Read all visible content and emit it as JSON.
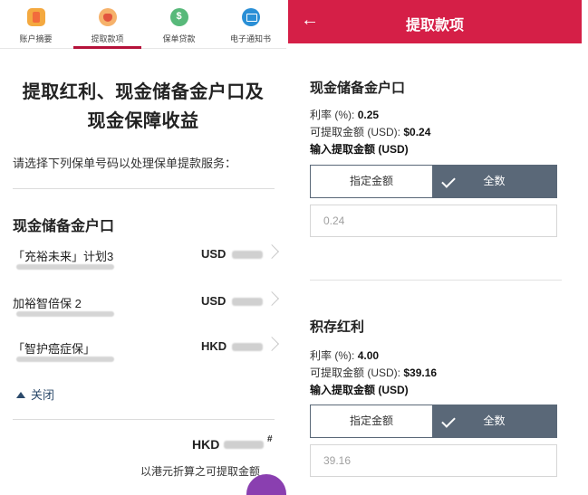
{
  "left_screen": {
    "tabs": [
      {
        "label": "账户摘要",
        "icon": "account-summary-icon"
      },
      {
        "label": "提取款项",
        "icon": "withdrawal-icon",
        "active": true
      },
      {
        "label": "保单贷款",
        "icon": "policy-loan-icon"
      },
      {
        "label": "电子通知书",
        "icon": "e-notice-mail-icon"
      }
    ],
    "title_line1": "提取红利、现金储备金户口及",
    "title_line2": "现金保障收益",
    "instruction": "请选择下列保单号码以处理保单提款服务：",
    "section_title": "现金储备金户口",
    "policies": [
      {
        "name": "「充裕未来」计划3",
        "currency": "USD"
      },
      {
        "name": "加裕智倍保 2",
        "currency": "USD"
      },
      {
        "name": "「智护癌症保」",
        "currency": "HKD"
      }
    ],
    "collapse_label": "关闭",
    "total_currency": "HKD",
    "total_mark": "#",
    "total_caption": "以港元折算之可提取金额"
  },
  "right_screen": {
    "header_title": "提取款项",
    "accent_color": "#d51f47",
    "toggle_color": "#5a6878",
    "sections": [
      {
        "title": "现金储备金户口",
        "rate_label": "利率 (%):",
        "rate_value": "0.25",
        "available_label": "可提取金额 (USD):",
        "available_value": "$0.24",
        "input_label": "输入提取金额 (USD)",
        "option_specified": "指定金额",
        "option_full": "全数",
        "selected_option": "全数",
        "amount_value": "0.24"
      },
      {
        "title": "积存红利",
        "rate_label": "利率 (%):",
        "rate_value": "4.00",
        "available_label": "可提取金额 (USD):",
        "available_value": "$39.16",
        "input_label": "输入提取金额 (USD)",
        "option_specified": "指定金额",
        "option_full": "全数",
        "selected_option": "全数",
        "amount_value": "39.16"
      }
    ]
  }
}
